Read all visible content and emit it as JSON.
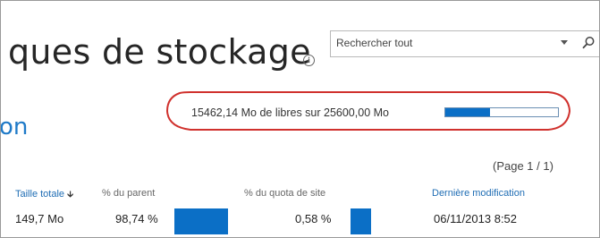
{
  "page": {
    "title": "ques de stockage",
    "subtitle": "on"
  },
  "search": {
    "placeholder": "Rechercher tout"
  },
  "storage": {
    "summary": "15462,14 Mo de libres sur 25600,00 Mo",
    "used_fraction": 0.396
  },
  "pagination": {
    "label": "(Page 1 / 1)"
  },
  "table": {
    "headers": {
      "total_size": "Taille totale",
      "pct_parent": "% du parent",
      "pct_quota": "% du quota de site",
      "last_modified": "Dernière modification"
    },
    "rows": [
      {
        "total_size": "149,7 Mo",
        "pct_parent": "98,74 %",
        "pct_parent_value": 0.9874,
        "pct_quota": "0,58 %",
        "pct_quota_value": 0.0058,
        "last_modified": "06/11/2013 8:52"
      }
    ]
  },
  "icons": {
    "info": "info-icon",
    "dropdown": "chevron-down-icon",
    "search": "search-icon",
    "sort": "sort-down-arrow-icon"
  },
  "colors": {
    "accent": "#0b6fc6",
    "link": "#1f6db4",
    "annotation": "#d0312d"
  }
}
